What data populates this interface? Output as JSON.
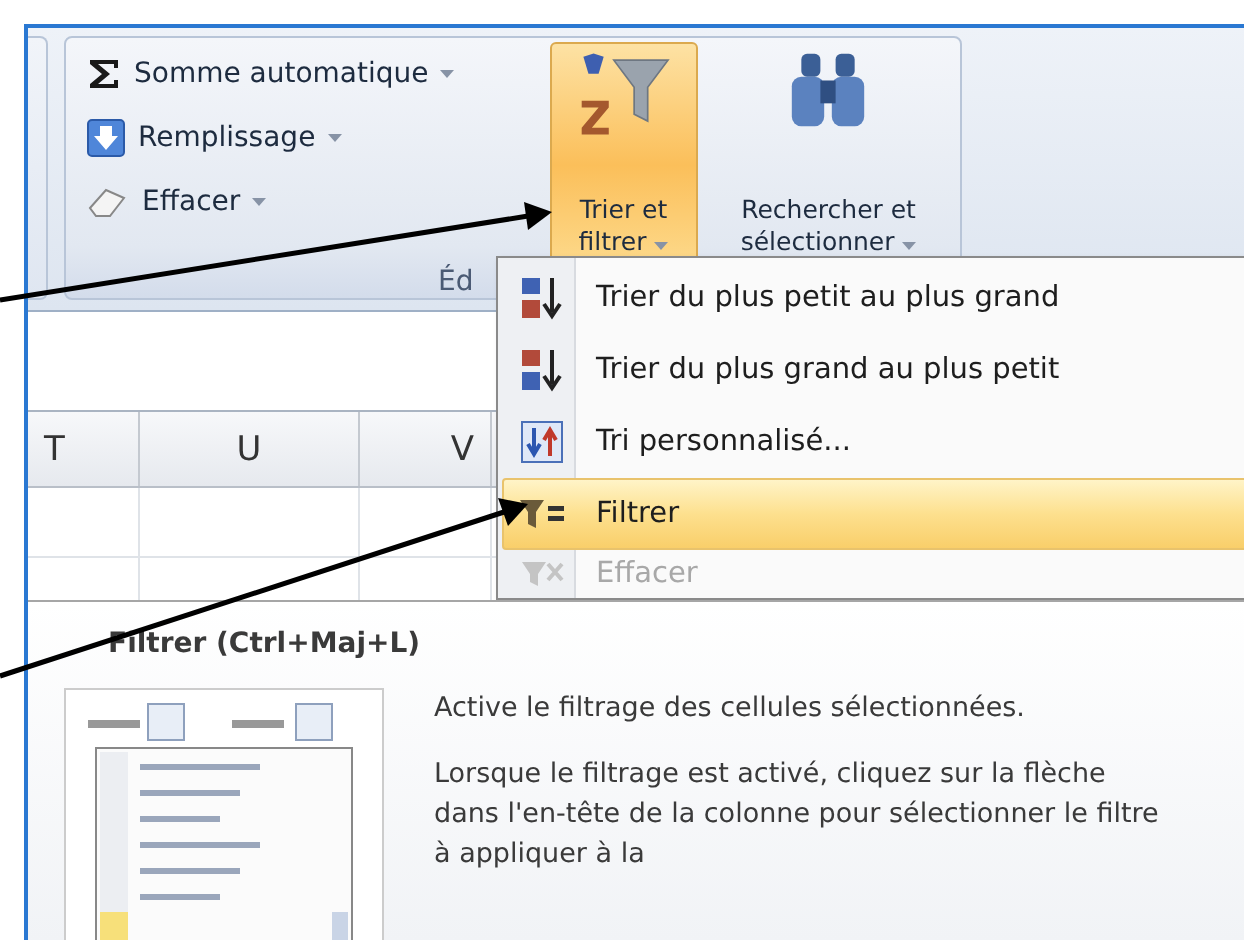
{
  "ribbon": {
    "small_buttons": [
      {
        "label": "Somme automatique",
        "dropdown": true
      },
      {
        "label": "Remplissage",
        "dropdown": true
      },
      {
        "label": "Effacer",
        "dropdown": true
      }
    ],
    "large_buttons": [
      {
        "label_lines": [
          "Trier et",
          "filtrer"
        ],
        "selected": true,
        "dropdown": true
      },
      {
        "label_lines": [
          "Rechercher et",
          "sélectionner"
        ],
        "selected": false,
        "dropdown": true
      }
    ],
    "group_label": "Éd"
  },
  "sheet": {
    "columns": [
      "T",
      "U",
      "V"
    ]
  },
  "menu": {
    "items": [
      {
        "label": "Trier du plus petit au plus grand",
        "selected": false,
        "disabled": false
      },
      {
        "label": "Trier du plus grand au plus petit",
        "selected": false,
        "disabled": false
      },
      {
        "label": "Tri personnalisé...",
        "selected": false,
        "disabled": false
      },
      {
        "label": "Filtrer",
        "selected": true,
        "disabled": false
      },
      {
        "label": "Effacer",
        "selected": false,
        "disabled": true
      }
    ]
  },
  "tooltip": {
    "title": "Filtrer (Ctrl+Maj+L)",
    "paragraphs": [
      "Active le filtrage des cellules sélectionnées.",
      "Lorsque le filtrage est activé, cliquez sur la flèche dans l'en-tête de la colonne pour sélectionner le filtre à appliquer à la"
    ]
  }
}
